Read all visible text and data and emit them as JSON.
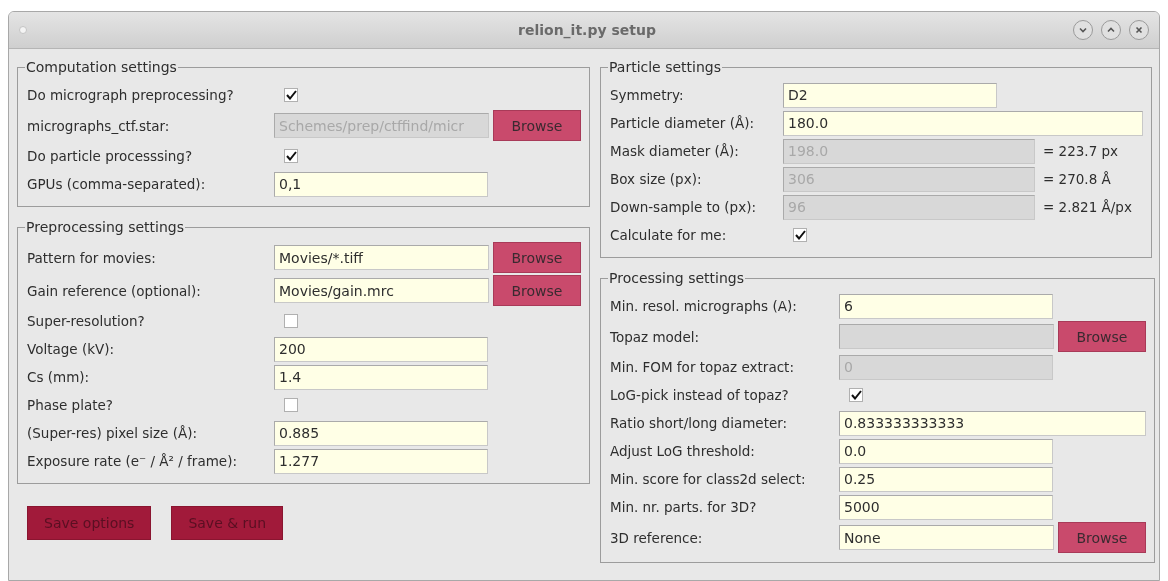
{
  "window": {
    "title": "relion_it.py setup"
  },
  "left": [
    {
      "title": "Computation settings",
      "rows": [
        {
          "kind": "check",
          "label": "Do micrograph preprocessing?",
          "checked": true
        },
        {
          "kind": "file",
          "label": "micrographs_ctf.star:",
          "value": "Schemes/prep/ctffind/micr",
          "disabled": true,
          "button": "Browse"
        },
        {
          "kind": "check",
          "label": "Do particle processsing?",
          "checked": true
        },
        {
          "kind": "entry",
          "label": "GPUs (comma-separated):",
          "value": "0,1",
          "disabled": false
        }
      ]
    },
    {
      "title": "Preprocessing settings",
      "rows": [
        {
          "kind": "file",
          "label": "Pattern for movies:",
          "value": "Movies/*.tiff",
          "disabled": false,
          "button": "Browse"
        },
        {
          "kind": "file",
          "label": "Gain reference (optional):",
          "value": "Movies/gain.mrc",
          "disabled": false,
          "button": "Browse"
        },
        {
          "kind": "check",
          "label": "Super-resolution?",
          "checked": false
        },
        {
          "kind": "entry",
          "label": "Voltage (kV):",
          "value": "200",
          "disabled": false
        },
        {
          "kind": "entry",
          "label": "Cs (mm):",
          "value": "1.4",
          "disabled": false
        },
        {
          "kind": "check",
          "label": "Phase plate?",
          "checked": false
        },
        {
          "kind": "entry",
          "label": "(Super-res) pixel size (Å):",
          "value": "0.885",
          "disabled": false
        },
        {
          "kind": "entry",
          "label": "Exposure rate (e⁻ / Å² / frame):",
          "value": "1.277",
          "disabled": false
        }
      ]
    }
  ],
  "actions": [
    "Save options",
    "Save & run"
  ],
  "right": [
    {
      "title": "Particle settings",
      "rows": [
        {
          "kind": "entry",
          "label": "Symmetry:",
          "value": "D2",
          "disabled": false
        },
        {
          "kind": "long_entry",
          "label": "Particle diameter (Å):",
          "value": "180.0",
          "disabled": false
        },
        {
          "kind": "computed",
          "label": "Mask diameter (Å):",
          "value": "198.0",
          "disabled": true,
          "result": "= 223.7 px"
        },
        {
          "kind": "computed",
          "label": "Box size (px):",
          "value": "306",
          "disabled": true,
          "result": "= 270.8 Å"
        },
        {
          "kind": "computed",
          "label": "Down-sample to (px):",
          "value": "96",
          "disabled": true,
          "result": "= 2.821 Å/px"
        },
        {
          "kind": "check",
          "label": "Calculate for me:",
          "checked": true
        }
      ]
    },
    {
      "title": "Processing settings",
      "rows": [
        {
          "kind": "entry",
          "label": "Min. resol. micrographs (A):",
          "value": "6",
          "disabled": false
        },
        {
          "kind": "file",
          "label": "Topaz model:",
          "disabled": true,
          "button": "Browse"
        },
        {
          "kind": "entry",
          "label": "Min. FOM for topaz extract:",
          "value": "0",
          "disabled": true
        },
        {
          "kind": "check",
          "label": "LoG-pick instead of topaz?",
          "checked": true
        },
        {
          "kind": "long_entry",
          "label": "Ratio short/long diameter:",
          "value": "0.833333333333",
          "disabled": false
        },
        {
          "kind": "entry",
          "label": "Adjust LoG threshold:",
          "value": "0.0",
          "disabled": false
        },
        {
          "kind": "entry",
          "label": "Min. score for class2d select:",
          "value": "0.25",
          "disabled": false
        },
        {
          "kind": "entry",
          "label": "Min. nr. parts. for 3D?",
          "value": "5000",
          "disabled": false
        },
        {
          "kind": "file",
          "label": "3D reference:",
          "value": "None",
          "disabled": false,
          "button": "Browse"
        }
      ]
    }
  ]
}
